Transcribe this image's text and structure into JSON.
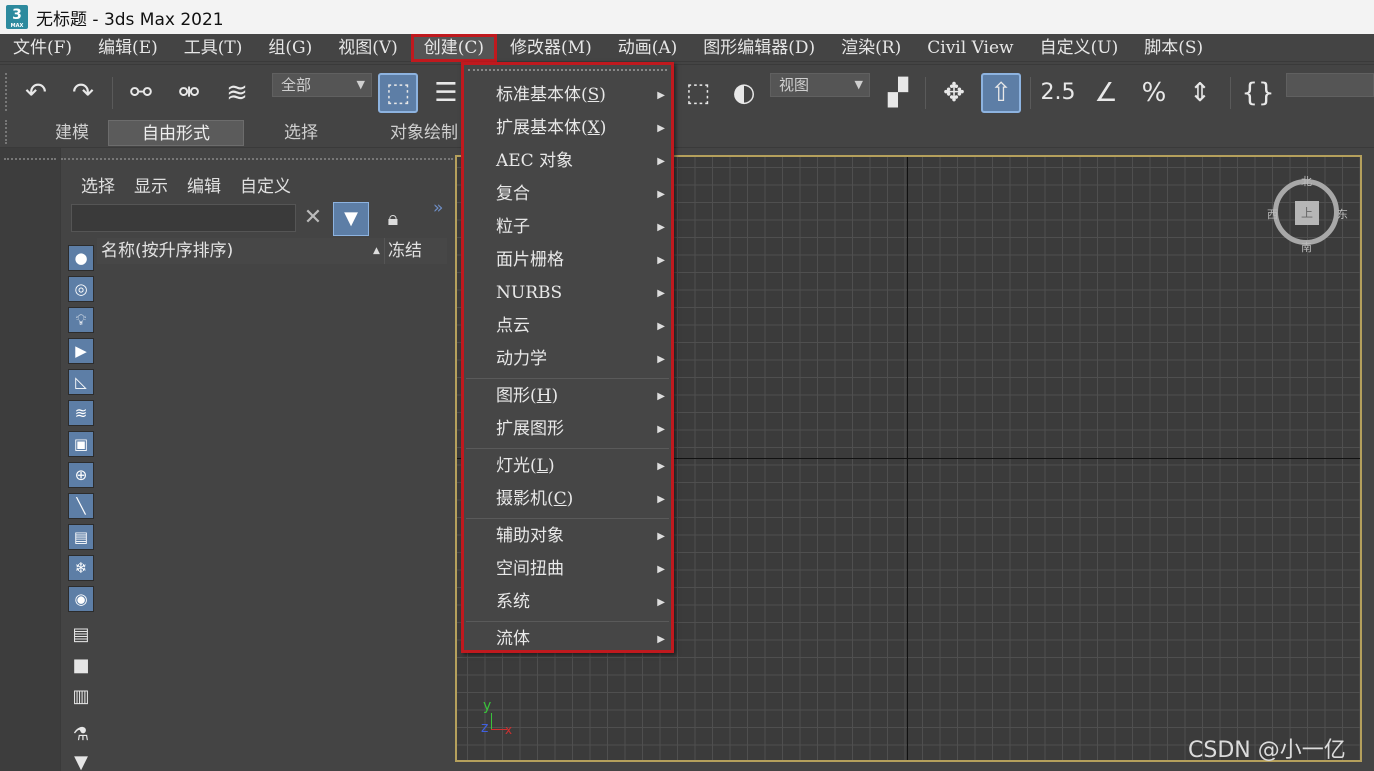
{
  "titlebar": {
    "logo": "3",
    "logo_sub": "MAX",
    "title": "无标题 - 3ds Max 2021"
  },
  "menubar": {
    "items": [
      "文件(F)",
      "编辑(E)",
      "工具(T)",
      "组(G)",
      "视图(V)",
      "创建(C)",
      "修改器(M)",
      "动画(A)",
      "图形编辑器(D)",
      "渲染(R)",
      "Civil View",
      "自定义(U)",
      "脚本(S)"
    ]
  },
  "toolbar": {
    "selection_filter": "全部",
    "ref_coord": "视图",
    "icons": [
      "undo-icon",
      "redo-icon",
      "link-icon",
      "unlink-icon",
      "bind-spacewarp-icon",
      "select-object-icon",
      "select-by-name-icon",
      "scale-icon",
      "snap-toggle-icon",
      "angle-snap-icon",
      "percent-snap-icon",
      "spinner-snap-icon",
      "named-selection-icon"
    ]
  },
  "ribbon": {
    "tabs": [
      "建模",
      "自由形式",
      "选择",
      "对象绘制"
    ]
  },
  "explorer": {
    "menus": [
      "选择",
      "显示",
      "编辑",
      "自定义"
    ],
    "search_value": "",
    "col_name": "名称(按升序排序)",
    "col_freeze": "冻结"
  },
  "create_menu": {
    "items": [
      {
        "label": "标准基本体(",
        "key": "S",
        "tail": ")"
      },
      {
        "label": "扩展基本体(",
        "key": "X",
        "tail": ")"
      },
      {
        "label": "AEC 对象",
        "key": "",
        "tail": ""
      },
      {
        "label": "复合",
        "key": "",
        "tail": ""
      },
      {
        "label": "粒子",
        "key": "",
        "tail": ""
      },
      {
        "label": "面片栅格",
        "key": "",
        "tail": ""
      },
      {
        "label": "NURBS",
        "key": "",
        "tail": ""
      },
      {
        "label": "点云",
        "key": "",
        "tail": ""
      },
      {
        "label": "动力学",
        "key": "",
        "tail": ""
      },
      {
        "label": "图形(",
        "key": "H",
        "tail": ")"
      },
      {
        "label": "扩展图形",
        "key": "",
        "tail": ""
      },
      {
        "label": "灯光(",
        "key": "L",
        "tail": ")"
      },
      {
        "label": "摄影机(",
        "key": "C",
        "tail": ")"
      },
      {
        "label": "辅助对象",
        "key": "",
        "tail": ""
      },
      {
        "label": "空间扭曲",
        "key": "",
        "tail": ""
      },
      {
        "label": "系统",
        "key": "",
        "tail": ""
      },
      {
        "label": "流体",
        "key": "",
        "tail": ""
      }
    ]
  },
  "viewport": {
    "compass": {
      "north": "北",
      "south": "南",
      "west": "西",
      "east": "东",
      "face": "上"
    },
    "gizmo": {
      "x": "x",
      "y": "y",
      "z": "z"
    }
  },
  "watermark": "CSDN @小一亿",
  "colors": {
    "highlight_red": "#c0191e",
    "accent_blue": "#5d7ea6",
    "viewport_border": "#b5a05c"
  }
}
